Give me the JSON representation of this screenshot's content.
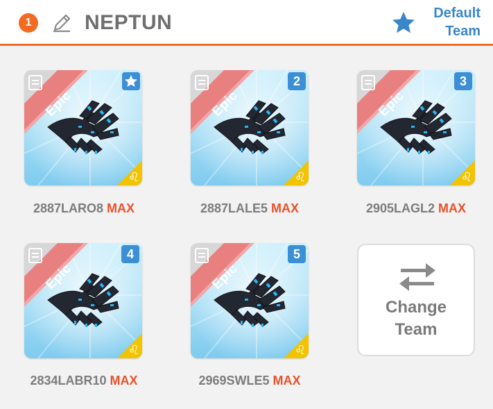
{
  "header": {
    "badge_count": "1",
    "team_name": "NEPTUN",
    "default_team_line1": "Default",
    "default_team_line2": "Team"
  },
  "cards": [
    {
      "corner": "",
      "rarity": "Epic",
      "name": "2887LARO8",
      "level": "MAX"
    },
    {
      "corner": "2",
      "rarity": "Epic",
      "name": "2887LALE5",
      "level": "MAX"
    },
    {
      "corner": "3",
      "rarity": "Epic",
      "name": "2905LAGL2",
      "level": "MAX"
    },
    {
      "corner": "4",
      "rarity": "Epic",
      "name": "2834LABR10",
      "level": "MAX"
    },
    {
      "corner": "5",
      "rarity": "Epic",
      "name": "2969SWLE5",
      "level": "MAX"
    }
  ],
  "change_team": {
    "line1": "Change",
    "line2": "Team"
  },
  "colors": {
    "accent": "#f26b21",
    "link": "#3a86c8",
    "max": "#e8522a",
    "corner_badge": "#3c8fd6",
    "epic_ribbon": "#e98080",
    "element_badge": "#f2c400"
  },
  "icons": {
    "edit": "pencil-icon",
    "default_team": "star-icon",
    "card_type": "clipboard-icon",
    "element": "leo-icon",
    "swap": "swap-arrows-icon"
  }
}
